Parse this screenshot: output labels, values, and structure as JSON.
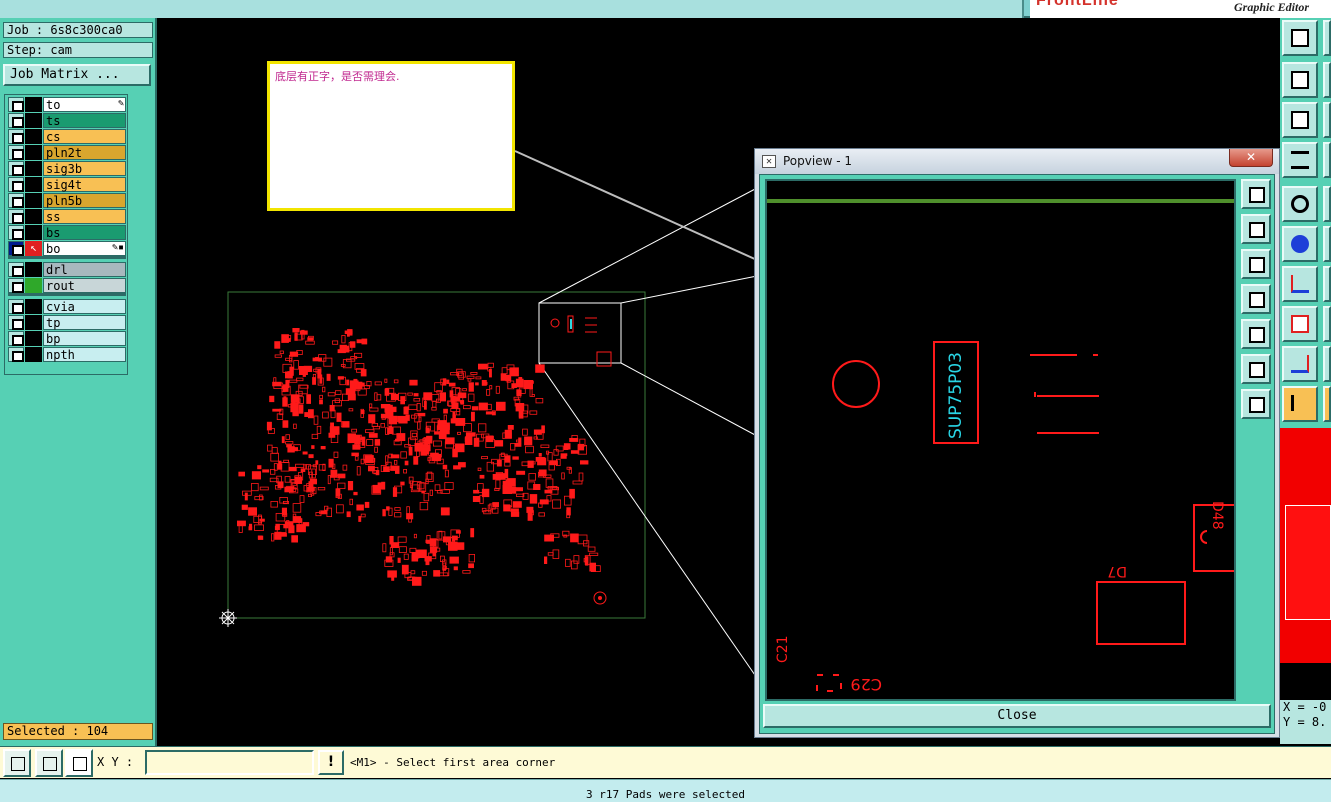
{
  "app": {
    "brand": "FrontLine",
    "subtitle": "Graphic Editor"
  },
  "left_panel": {
    "job": "Job : 6s8c300ca0",
    "step": "Step: cam",
    "job_matrix_label": "Job Matrix ...",
    "selected": "Selected : 104",
    "layers": [
      {
        "name": "to",
        "color": "#ffffff",
        "editable": true
      },
      {
        "name": "ts",
        "color": "#1a9b70"
      },
      {
        "name": "cs",
        "color": "#f8c054"
      },
      {
        "name": "pln2t",
        "color": "#d9a62e"
      },
      {
        "name": "sig3b",
        "color": "#f8c054"
      },
      {
        "name": "sig4t",
        "color": "#f8c054"
      },
      {
        "name": "pln5b",
        "color": "#d9a62e"
      },
      {
        "name": "ss",
        "color": "#f8c054"
      },
      {
        "name": "bs",
        "color": "#1a9b70"
      },
      {
        "name": "bo",
        "color": "#ffffff",
        "work_layer": true,
        "editable": true
      },
      {
        "name": "drl",
        "color": "#a8b8be"
      },
      {
        "name": "rout",
        "color": "#c8d6d8",
        "green": true
      },
      {
        "name": "cvia",
        "color": "#c8eef0"
      },
      {
        "name": "tp",
        "color": "#c8eef0"
      },
      {
        "name": "bp",
        "color": "#c8eef0"
      },
      {
        "name": "npth",
        "color": "#c8eef0"
      }
    ]
  },
  "canvas": {
    "note_text": "底层有正字，是否需理会.",
    "board_color": "#ff1a1a",
    "profile_color": "#3a7a3a"
  },
  "popview": {
    "title": "Popview - 1",
    "close_label": "Close",
    "window_close_glyph": "✕",
    "component_text": "SUP75P03",
    "labels": [
      "D7",
      "D48",
      "C21",
      "C29"
    ]
  },
  "coords": {
    "x": "X = -0",
    "y": "Y = 8."
  },
  "command_bar": {
    "xy_label": "X Y :",
    "xy_value": "",
    "alert_glyph": "!",
    "prompt": "<M1> - Select first area corner"
  },
  "status": {
    "message": "3 r17 Pads were selected"
  }
}
